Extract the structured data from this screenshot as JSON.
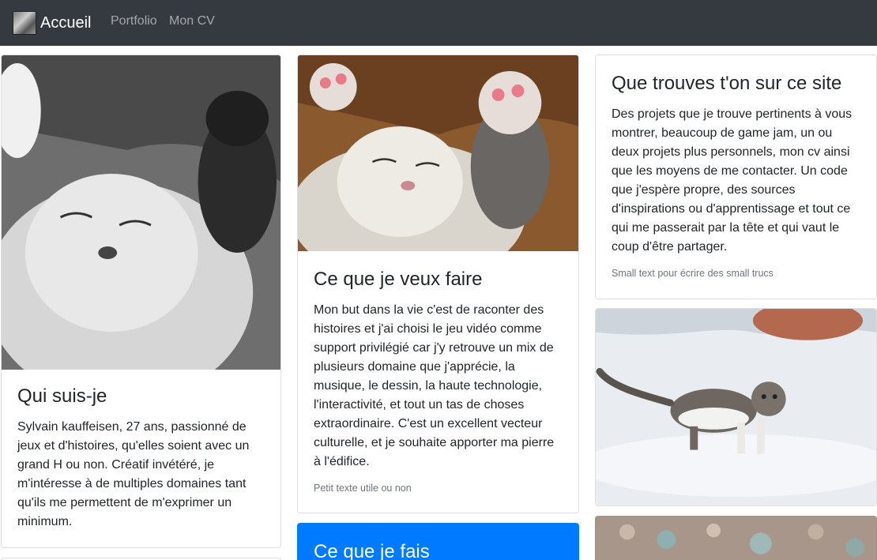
{
  "nav": {
    "brand": "Accueil",
    "links": [
      "Portfolio",
      "Mon CV"
    ]
  },
  "cards": {
    "who": {
      "title": "Qui suis-je",
      "text": "Sylvain kauffeisen, 27 ans, passionné de jeux et d'histoires, qu'elles soient avec un grand H ou non. Créatif invétéré, je m'intéresse à de multiples domaines tant qu'ils me permettent de m'exprimer un minimum."
    },
    "want": {
      "title": "Ce que je veux faire",
      "text": "Mon but dans la vie c'est de raconter des histoires et j'ai choisi le jeu vidéo comme support privilégié car j'y retrouve un mix de plusieurs domaine que j'apprécie, la musique, le dessin, la haute technologie, l'interactivité, et tout un tas de choses extraordinaire. C'est un excellent vecteur culturelle, et je souhaite apporter ma pierre à l'édifice.",
      "small": "Petit texte utile ou non"
    },
    "site": {
      "title": "Que trouves t'on sur ce site",
      "text": "Des projets que je trouve pertinents à vous montrer, beaucoup de game jam, un ou deux projets plus personnels, mon cv ainsi que les moyens de me contacter. Un code que j'espère propre, des sources d'inspirations ou d'apprentissage et tout ce qui me passerait par la tête et qui vaut le coup d'être partager.",
      "small": "Small text pour écrire des small trucs"
    },
    "do": {
      "title": "Ce que je fais"
    }
  },
  "colors": {
    "navbar": "#343a40",
    "primary": "#007bff"
  }
}
